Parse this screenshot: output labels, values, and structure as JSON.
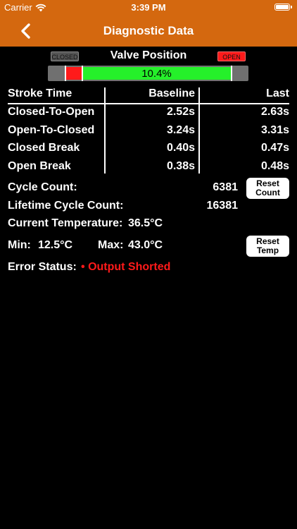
{
  "status_bar": {
    "carrier": "Carrier",
    "time": "3:39 PM"
  },
  "nav": {
    "title": "Diagnostic Data"
  },
  "valve": {
    "title": "Valve Position",
    "closed_label": "CLOSED",
    "open_label": "OPEN",
    "percent": "10.4%"
  },
  "stroke_table": {
    "headers": [
      "Stroke Time",
      "Baseline",
      "Last"
    ],
    "rows": [
      {
        "label": "Closed-To-Open",
        "baseline": "2.52s",
        "last": "2.63s"
      },
      {
        "label": "Open-To-Closed",
        "baseline": "3.24s",
        "last": "3.31s"
      },
      {
        "label": "Closed Break",
        "baseline": "0.40s",
        "last": "0.47s"
      },
      {
        "label": "Open Break",
        "baseline": "0.38s",
        "last": "0.48s"
      }
    ]
  },
  "counts": {
    "cycle_label": "Cycle Count:",
    "cycle_value": "6381",
    "lifetime_label": "Lifetime Cycle Count:",
    "lifetime_value": "16381",
    "reset_count_label": "Reset Count"
  },
  "temperature": {
    "current_label": "Current Temperature:",
    "current_value": "36.5°C",
    "min_label": "Min:",
    "min_value": "12.5°C",
    "max_label": "Max:",
    "max_value": "43.0°C",
    "reset_temp_label": "Reset Temp"
  },
  "error": {
    "label": "Error Status:",
    "bullet": "•",
    "value": "Output Shorted"
  },
  "colors": {
    "accent": "#d4680f",
    "valve_open_fill": "#25f02a",
    "valve_closed_fill": "#ff1a1a",
    "error": "#ff1a1a"
  }
}
